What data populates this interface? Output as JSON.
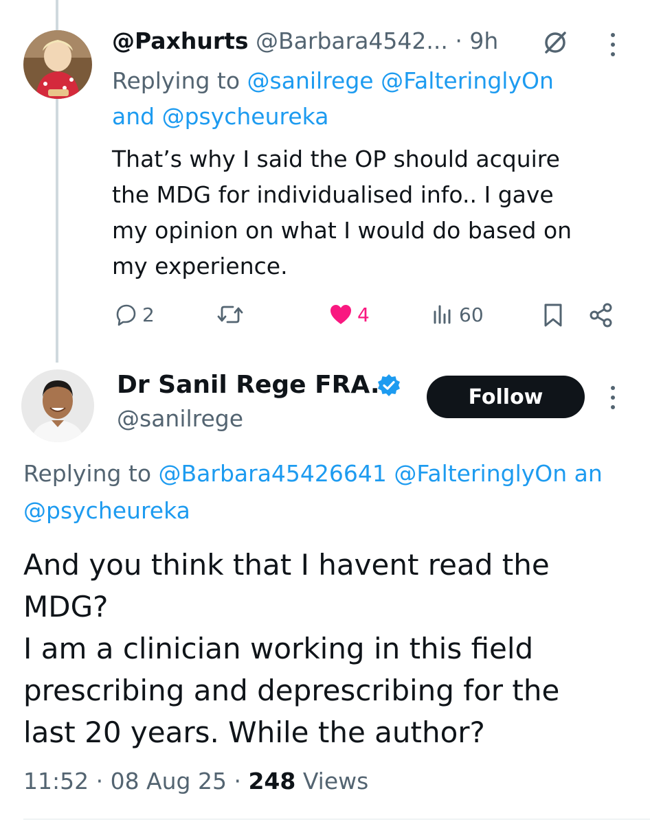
{
  "reply": {
    "display_name": "@Paxhurts",
    "handle": "@Barbara4542...",
    "time": "· 9h",
    "replying_prefix": "Replying to ",
    "replying_mentions": [
      "@sanilrege",
      "@FalteringlyOn"
    ],
    "replying_and": "and ",
    "replying_last": "@psycheureka",
    "body_lines": [
      "That’s why I said the OP should  acquire",
      "the MDG for individualised info.. I gave",
      "my opinion on what I would do based on",
      "my experience."
    ],
    "stats": {
      "replies": "2",
      "likes": "4",
      "views": "60"
    },
    "colors": {
      "like": "#f91880",
      "link": "#1d9bf0"
    }
  },
  "main": {
    "display_name": "Dr Sanil Rege FRA...",
    "handle": "@sanilrege",
    "follow_label": "Follow",
    "replying_prefix": "Replying to ",
    "replying_line1_mentions": "@Barbara45426641 @FalteringlyOn an",
    "replying_line2": "@psycheureka",
    "body_lines": [
      "And you think that I havent read the",
      "MDG?",
      "I am a clinician working in this field",
      "prescribing and deprescribing for the",
      "last 20 years. While the author?"
    ],
    "timestamp": "11:52 · 08 Aug 25 · ",
    "views_count": "248",
    "views_label": " Views"
  },
  "icons": {
    "verified": "verified-badge-icon",
    "grok": "no-entry-circle-icon",
    "reply": "speech-bubble-icon",
    "retweet": "retweet-icon",
    "like": "heart-icon",
    "views": "bar-chart-icon",
    "bookmark": "bookmark-icon",
    "share": "share-icon"
  }
}
